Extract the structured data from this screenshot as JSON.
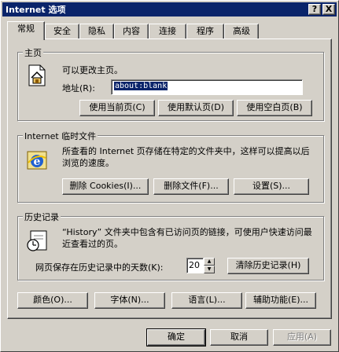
{
  "window": {
    "title": "Internet 选项",
    "help_btn": "?",
    "close_btn": "X"
  },
  "tabs": [
    {
      "label": "常规"
    },
    {
      "label": "安全"
    },
    {
      "label": "隐私"
    },
    {
      "label": "内容"
    },
    {
      "label": "连接"
    },
    {
      "label": "程序"
    },
    {
      "label": "高级"
    }
  ],
  "homepage": {
    "legend": "主页",
    "desc": "可以更改主页。",
    "address_label": "地址(R):",
    "address_value": "about:blank",
    "btn_current": "使用当前页(C)",
    "btn_default": "使用默认页(D)",
    "btn_blank": "使用空白页(B)"
  },
  "temp_files": {
    "legend": "Internet 临时文件",
    "desc": "所查看的 Internet 页存储在特定的文件夹中，这样可以提高以后浏览的速度。",
    "btn_delete_cookies": "删除 Cookies(I)...",
    "btn_delete_files": "删除文件(F)...",
    "btn_settings": "设置(S)..."
  },
  "history": {
    "legend": "历史记录",
    "desc": "“History” 文件夹中包含有已访问页的链接，可使用户快速访问最近查看过的页。",
    "days_label": "网页保存在历史记录中的天数(K):",
    "days_value": "20",
    "btn_clear": "清除历史记录(H)"
  },
  "bottom_buttons": {
    "colors": "颜色(O)...",
    "fonts": "字体(N)...",
    "languages": "语言(L)...",
    "accessibility": "辅助功能(E)..."
  },
  "dialog_buttons": {
    "ok": "确定",
    "cancel": "取消",
    "apply": "应用(A)"
  },
  "colors": {
    "titlebar": "#0a246a",
    "face": "#d4d0c8",
    "selection": "#0a246a"
  }
}
